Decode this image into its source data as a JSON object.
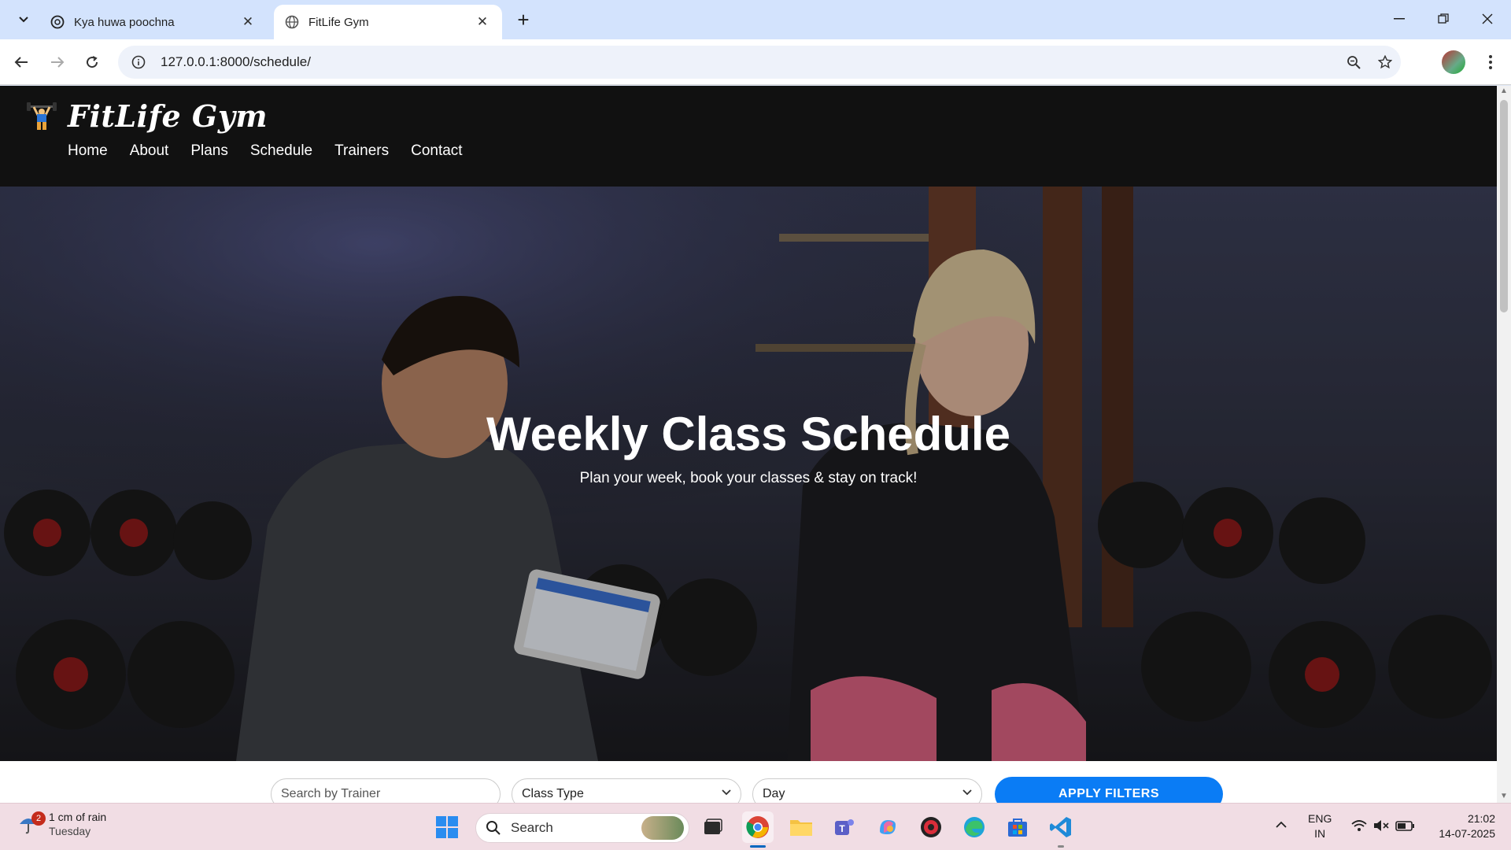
{
  "browser": {
    "tabs": [
      {
        "title": "Kya huwa poochna",
        "active": false
      },
      {
        "title": "FitLife Gym",
        "active": true
      }
    ],
    "url": "127.0.0.1:8000/schedule/"
  },
  "site": {
    "brand": "FitLife Gym",
    "nav": [
      "Home",
      "About",
      "Plans",
      "Schedule",
      "Trainers",
      "Contact"
    ],
    "hero": {
      "title": "Weekly Class Schedule",
      "subtitle": "Plan your week, book your classes & stay on track!"
    },
    "filters": {
      "trainer_placeholder": "Search by Trainer",
      "class_type": "Class Type",
      "day": "Day",
      "apply_label": "APPLY FILTERS"
    }
  },
  "taskbar": {
    "weather_badge": "2",
    "weather_line1": "1 cm of rain",
    "weather_line2": "Tuesday",
    "search_label": "Search",
    "lang_line1": "ENG",
    "lang_line2": "IN",
    "time": "21:02",
    "date": "14-07-2025"
  },
  "colors": {
    "accent": "#0a7cf5",
    "header_bg": "#111111",
    "taskbar_bg": "#f1dde4"
  }
}
